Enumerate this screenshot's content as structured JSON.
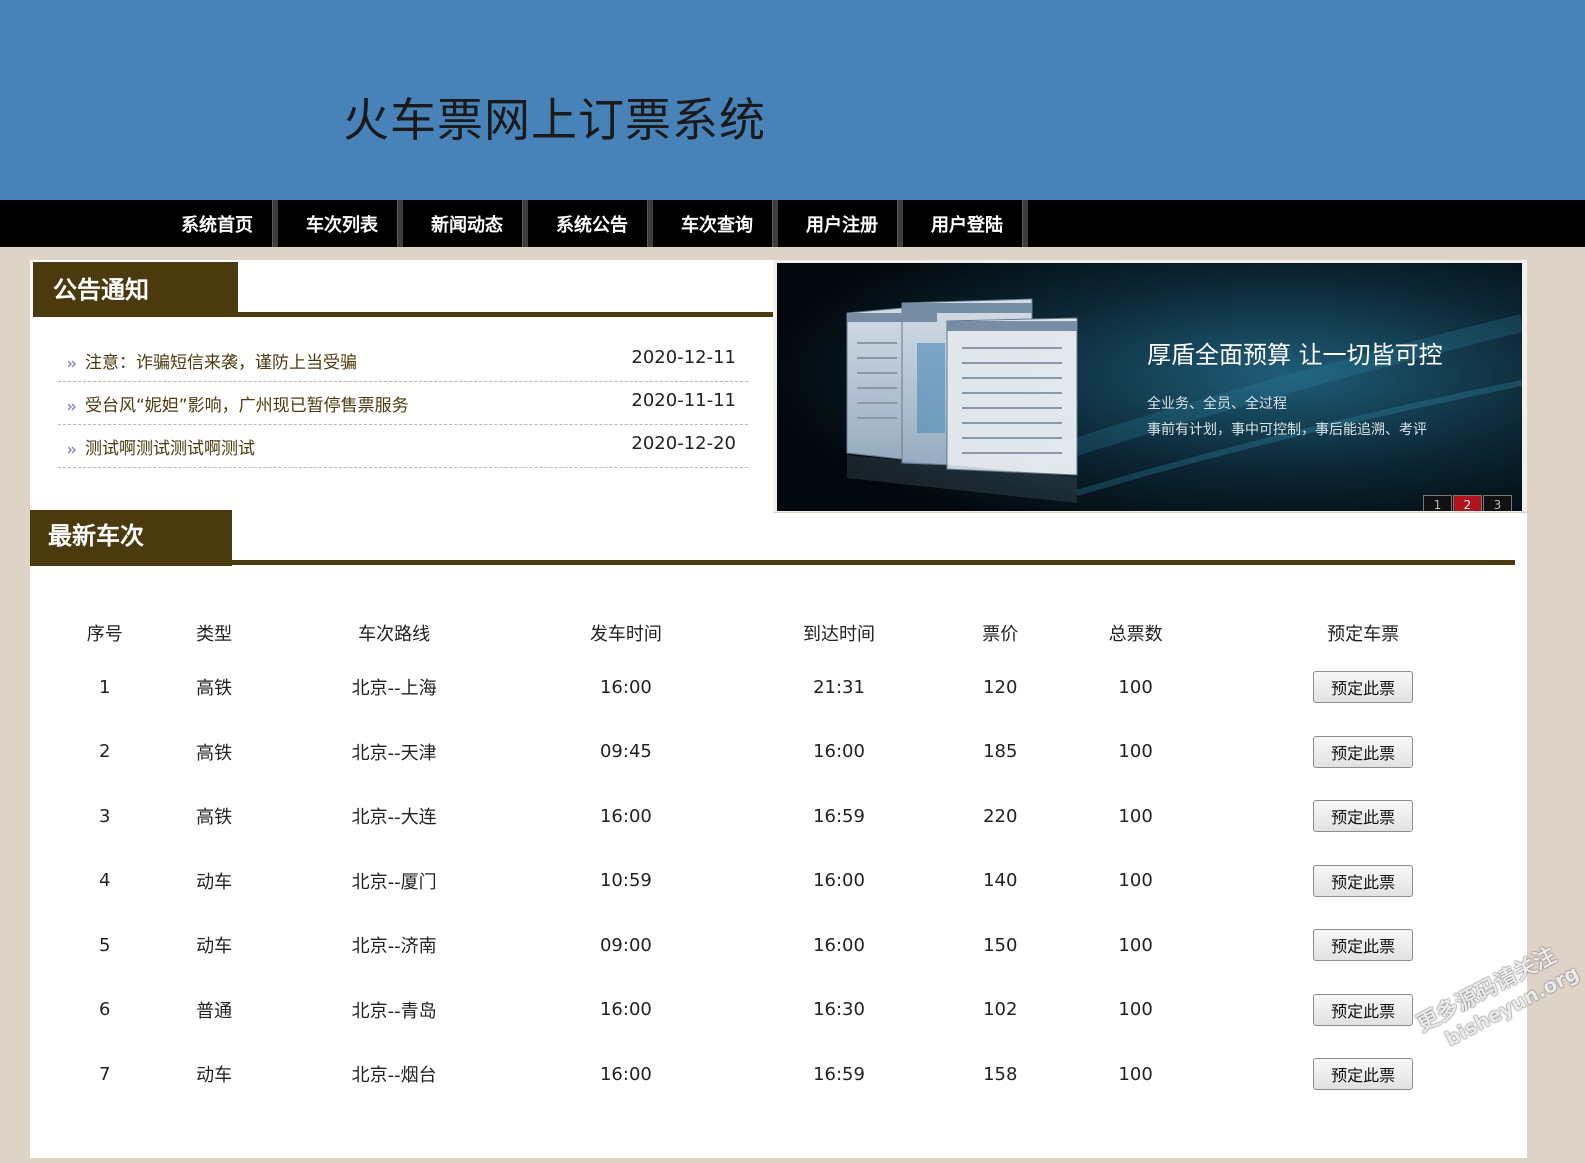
{
  "site_title": "火车票网上订票系统",
  "nav": [
    "系统首页",
    "车次列表",
    "新闻动态",
    "系统公告",
    "车次查询",
    "用户注册",
    "用户登陆"
  ],
  "notice_section": {
    "title": "公告通知",
    "items": [
      {
        "title": "注意：诈骗短信来袭，谨防上当受骗",
        "date": "2020-12-11"
      },
      {
        "title": "受台风“妮妲”影响，广州现已暂停售票服务",
        "date": "2020-11-11"
      },
      {
        "title": "测试啊测试测试啊测试",
        "date": "2020-12-20"
      }
    ]
  },
  "banner": {
    "headline": "厚盾全面预算  让一切皆可控",
    "line1": "全业务、全员、全过程",
    "line2": "事前有计划，事中可控制，事后能追溯、考评",
    "pages": [
      "1",
      "2",
      "3"
    ],
    "active_page": "2"
  },
  "trains_section": {
    "title": "最新车次",
    "headers": [
      "序号",
      "类型",
      "车次路线",
      "发车时间",
      "到达时间",
      "票价",
      "总票数",
      "预定车票"
    ],
    "book_label": "预定此票",
    "rows": [
      {
        "no": "1",
        "type": "高铁",
        "route": "北京--上海",
        "depart": "16:00",
        "arrive": "21:31",
        "price": "120",
        "total": "100"
      },
      {
        "no": "2",
        "type": "高铁",
        "route": "北京--天津",
        "depart": "09:45",
        "arrive": "16:00",
        "price": "185",
        "total": "100"
      },
      {
        "no": "3",
        "type": "高铁",
        "route": "北京--大连",
        "depart": "16:00",
        "arrive": "16:59",
        "price": "220",
        "total": "100"
      },
      {
        "no": "4",
        "type": "动车",
        "route": "北京--厦门",
        "depart": "10:59",
        "arrive": "16:00",
        "price": "140",
        "total": "100"
      },
      {
        "no": "5",
        "type": "动车",
        "route": "北京--济南",
        "depart": "09:00",
        "arrive": "16:00",
        "price": "150",
        "total": "100"
      },
      {
        "no": "6",
        "type": "普通",
        "route": "北京--青岛",
        "depart": "16:00",
        "arrive": "16:30",
        "price": "102",
        "total": "100"
      },
      {
        "no": "7",
        "type": "动车",
        "route": "北京--烟台",
        "depart": "16:00",
        "arrive": "16:59",
        "price": "158",
        "total": "100"
      }
    ]
  },
  "watermark": {
    "line1": "更多源码请关注",
    "line2": "bisheyun.org"
  },
  "colors": {
    "header_bg": "#4783b8",
    "nav_bg": "#000000",
    "section_brown": "#4a3a0d",
    "page_bg": "#ddd3c6",
    "pager_active": "#b3141b"
  }
}
